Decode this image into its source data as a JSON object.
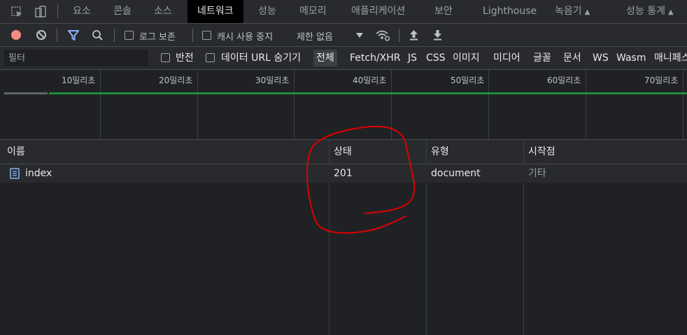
{
  "tabs": [
    {
      "label": "요소"
    },
    {
      "label": "콘솔"
    },
    {
      "label": "소스"
    },
    {
      "label": "네트워크"
    },
    {
      "label": "성능"
    },
    {
      "label": "메모리"
    },
    {
      "label": "애플리케이션"
    },
    {
      "label": "보안"
    },
    {
      "label": "Lighthouse"
    },
    {
      "label": "녹음기"
    },
    {
      "label": "성능 통계"
    }
  ],
  "toolbar": {
    "preserve_log": "로그 보존",
    "disable_cache": "캐시 사용 중지",
    "throttling": "제한 없음"
  },
  "filterbar": {
    "placeholder": "필터",
    "invert": "반전",
    "hide_data_urls": "데이터 URL 숨기기",
    "types": [
      "전체",
      "Fetch/XHR",
      "JS",
      "CSS",
      "이미지",
      "미디어",
      "글꼴",
      "문서",
      "WS",
      "Wasm",
      "매니페스"
    ]
  },
  "timeline": {
    "ticks": [
      "10밀리초",
      "20밀리초",
      "30밀리초",
      "40밀리초",
      "50밀리초",
      "60밀리초",
      "70밀리초"
    ]
  },
  "table": {
    "columns": [
      "이름",
      "상태",
      "유형",
      "시작점"
    ],
    "rows": [
      {
        "name": "index",
        "status": "201",
        "type": "document",
        "initiator": "기타"
      }
    ]
  },
  "colors": {
    "record": "#f28b82",
    "filter_active": "#8ab4f8",
    "annotation": "#e00000",
    "timeline_bar": "#1e8e3e"
  }
}
